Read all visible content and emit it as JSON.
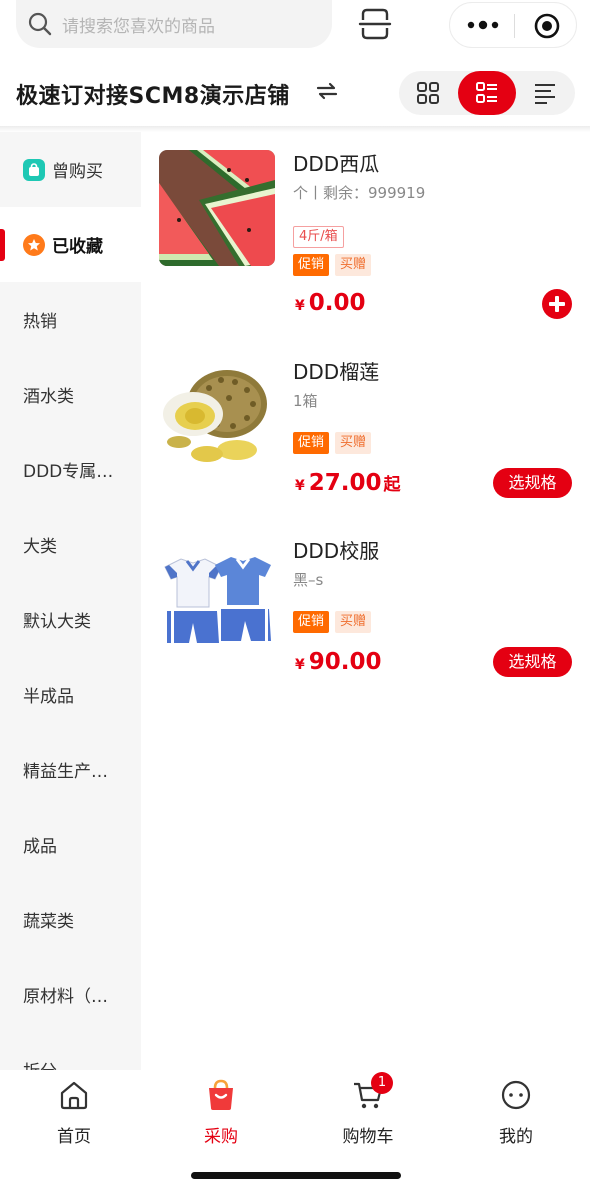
{
  "search": {
    "placeholder": "请搜索您喜欢的商品"
  },
  "store": {
    "name": "极速订对接SCM8演示店铺"
  },
  "view_modes": [
    "grid",
    "list",
    "text-list"
  ],
  "active_view": "list",
  "colors": {
    "accent": "#e40012",
    "promo_tag": "#ff6a00",
    "gift_tag_bg": "#fde8dc"
  },
  "sidebar": {
    "items": [
      {
        "label": "曾购买",
        "icon": "bag-icon"
      },
      {
        "label": "已收藏",
        "icon": "star-icon",
        "active": true
      },
      {
        "label": "热销"
      },
      {
        "label": "酒水类"
      },
      {
        "label": "DDD专属…"
      },
      {
        "label": "大类"
      },
      {
        "label": "默认大类"
      },
      {
        "label": "半成品"
      },
      {
        "label": "精益生产…"
      },
      {
        "label": "成品"
      },
      {
        "label": "蔬菜类"
      },
      {
        "label": "原材料（…"
      },
      {
        "label": "折分"
      }
    ]
  },
  "products": [
    {
      "name": "DDD西瓜",
      "spec": "个丨剩余：999919",
      "package": "4斤/箱",
      "tags": [
        "促销",
        "买赠"
      ],
      "currency": "¥",
      "price": "0.00",
      "price_suffix": "",
      "action": "add-icon"
    },
    {
      "name": "DDD榴莲",
      "spec": "1箱",
      "tags": [
        "促销",
        "买赠"
      ],
      "currency": "¥",
      "price": "27.00",
      "price_suffix": "起",
      "action_label": "选规格"
    },
    {
      "name": "DDD校服",
      "spec": "黑–s",
      "tags": [
        "促销",
        "买赠"
      ],
      "currency": "¥",
      "price": "90.00",
      "price_suffix": "",
      "action_label": "选规格"
    }
  ],
  "tabbar": {
    "items": [
      {
        "label": "首页",
        "icon": "home-icon"
      },
      {
        "label": "采购",
        "icon": "shopping-bag-icon",
        "active": true
      },
      {
        "label": "购物车",
        "icon": "cart-icon",
        "badge": "1"
      },
      {
        "label": "我的",
        "icon": "smile-icon"
      }
    ]
  }
}
